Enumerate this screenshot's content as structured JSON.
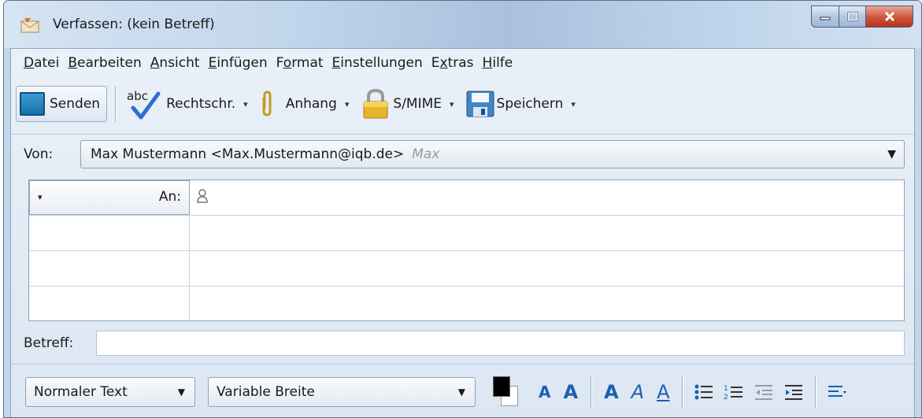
{
  "window": {
    "title": "Verfassen: (kein Betreff)"
  },
  "menu": [
    {
      "label": "Datei",
      "accel": "D"
    },
    {
      "label": "Bearbeiten",
      "accel": "B"
    },
    {
      "label": "Ansicht",
      "accel": "A"
    },
    {
      "label": "Einfügen",
      "accel": "E"
    },
    {
      "label": "Format",
      "accel": "o"
    },
    {
      "label": "Einstellungen",
      "accel": "E"
    },
    {
      "label": "Extras",
      "accel": "x"
    },
    {
      "label": "Hilfe",
      "accel": "H"
    }
  ],
  "toolbar": {
    "send": "Senden",
    "spell_icon_text": "abc",
    "spell": "Rechtschr.",
    "attach": "Anhang",
    "smime": "S/MIME",
    "save": "Speichern"
  },
  "from": {
    "label": "Von:",
    "value": "Max Mustermann <Max.Mustermann@iqb.de>",
    "alias": "Max"
  },
  "recipients": [
    {
      "type": "An:",
      "value": ""
    },
    {
      "type": "",
      "value": ""
    },
    {
      "type": "",
      "value": ""
    },
    {
      "type": "",
      "value": ""
    }
  ],
  "subject": {
    "label": "Betreff:",
    "value": ""
  },
  "format_toolbar": {
    "paragraph_format": "Normaler Text",
    "font": "Variable Breite",
    "text_color": "#000000",
    "background_color": "#ffffff",
    "smaller": "A",
    "larger": "A",
    "bold": "A",
    "italic": "A",
    "underline": "A"
  }
}
